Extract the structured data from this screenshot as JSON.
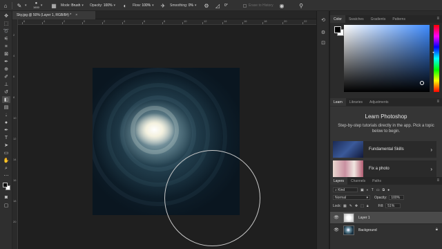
{
  "options_bar": {
    "brush_size": "1600",
    "mode_label": "Mode:",
    "mode_value": "Brush",
    "opacity_label": "Opacity:",
    "opacity_value": "100%",
    "flow_label": "Flow:",
    "flow_value": "100%",
    "smoothing_label": "Smoothing:",
    "smoothing_value": "0%",
    "angle_value": "0°",
    "erase_history_label": "Erase to History"
  },
  "document": {
    "tab_title": "Sky.jpg @ 50% (Layer 1, RGB/8#) *",
    "close": "×"
  },
  "rulers": {
    "top_ticks": [
      "6",
      "4",
      "2",
      "0",
      "2",
      "4",
      "6",
      "8",
      "10",
      "12",
      "14",
      "16",
      "18",
      "20",
      "22"
    ],
    "left_ticks": [
      "2",
      "4",
      "6",
      "8",
      "10",
      "12",
      "14",
      "16",
      "18",
      "20"
    ]
  },
  "color_panel": {
    "tabs": [
      "Color",
      "Swatches",
      "Gradients",
      "Patterns"
    ],
    "active_tab": "Color",
    "foreground": "#000000",
    "background": "#ffffff",
    "hue_color": "#3f8cff"
  },
  "learn_panel": {
    "tabs": [
      "Learn",
      "Libraries",
      "Adjustments"
    ],
    "active_tab": "Learn",
    "title": "Learn Photoshop",
    "description": "Step-by-step tutorials directly in the app. Pick a topic below to begin.",
    "cards": [
      {
        "label": "Fundamental Skills",
        "chevron": "›"
      },
      {
        "label": "Fix a photo",
        "chevron": "›"
      }
    ]
  },
  "layers_panel": {
    "tabs": [
      "Layers",
      "Channels",
      "Paths"
    ],
    "active_tab": "Layers",
    "kind_label": "Kind",
    "blend_mode": "Normal",
    "opacity_label": "Opacity:",
    "opacity_value": "100%",
    "lock_label": "Lock:",
    "fill_label": "Fill:",
    "fill_value": "51%",
    "layers": [
      {
        "name": "Layer 1",
        "selected": true
      },
      {
        "name": "Background",
        "selected": false
      }
    ]
  }
}
